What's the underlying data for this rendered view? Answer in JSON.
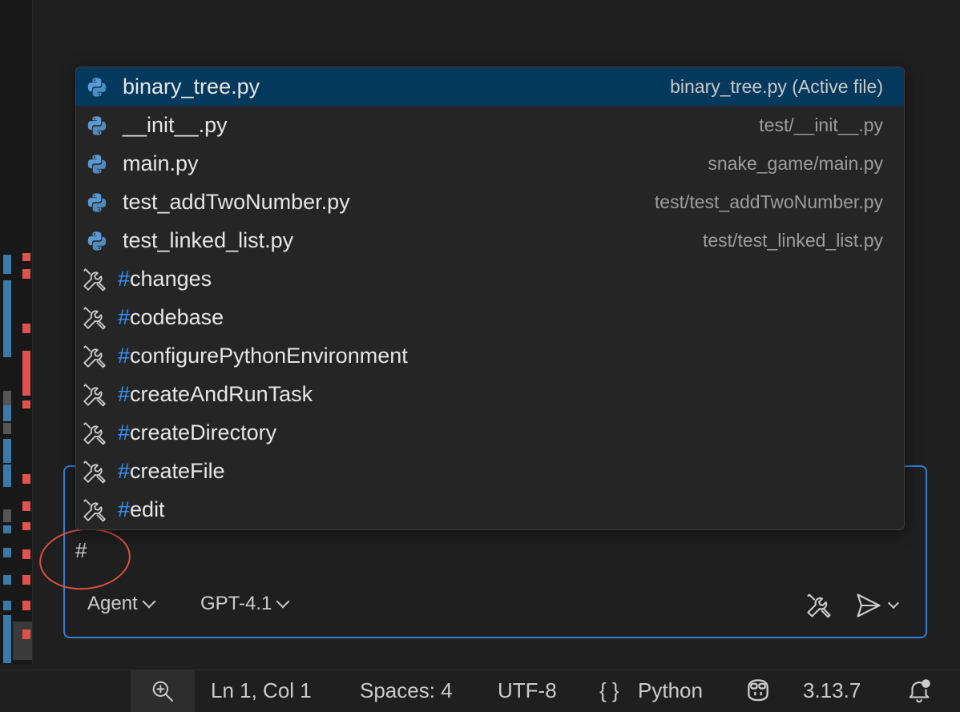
{
  "dropdown": {
    "items": [
      {
        "kind": "file",
        "label": "binary_tree.py",
        "desc": "binary_tree.py (Active file)",
        "active": true,
        "icon": "python-icon"
      },
      {
        "kind": "file",
        "label": "__init__.py",
        "desc": "test/__init__.py",
        "icon": "python-icon"
      },
      {
        "kind": "file",
        "label": "main.py",
        "desc": "snake_game/main.py",
        "icon": "python-icon"
      },
      {
        "kind": "file",
        "label": "test_addTwoNumber.py",
        "desc": "test/test_addTwoNumber.py",
        "icon": "python-icon"
      },
      {
        "kind": "file",
        "label": "test_linked_list.py",
        "desc": "test/test_linked_list.py",
        "icon": "python-icon"
      },
      {
        "kind": "tool",
        "label": "changes",
        "icon": "tools-icon"
      },
      {
        "kind": "tool",
        "label": "codebase",
        "icon": "tools-icon"
      },
      {
        "kind": "tool",
        "label": "configurePythonEnvironment",
        "icon": "tools-icon"
      },
      {
        "kind": "tool",
        "label": "createAndRunTask",
        "icon": "tools-icon"
      },
      {
        "kind": "tool",
        "label": "createDirectory",
        "icon": "tools-icon"
      },
      {
        "kind": "tool",
        "label": "createFile",
        "icon": "tools-icon"
      },
      {
        "kind": "tool",
        "label": "edit",
        "icon": "tools-icon"
      }
    ],
    "hash_prefix": "#"
  },
  "chat": {
    "input_value": "#",
    "mode_label": "Agent",
    "model_label": "GPT-4.1"
  },
  "status": {
    "position": "Ln 1, Col 1",
    "spaces": "Spaces: 4",
    "encoding": "UTF-8",
    "lang_braces": "{ }",
    "language": "Python",
    "version": "3.13.7"
  },
  "colors": {
    "accent": "#2f7fd1",
    "active_row": "#04395e",
    "hash": "#3794ff",
    "python_blue": "#5b9bd5",
    "annotation": "#d9503f"
  }
}
